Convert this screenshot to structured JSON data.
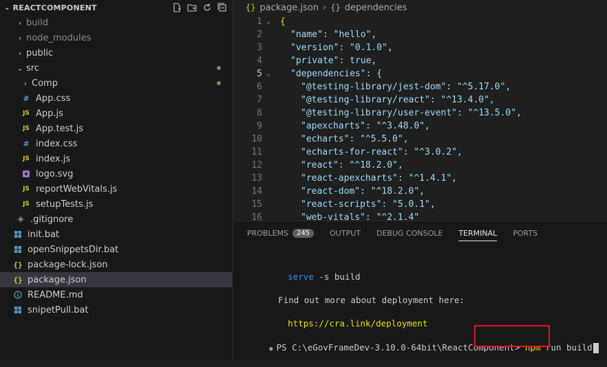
{
  "explorer": {
    "title": "REACTCOMPONENT",
    "items": [
      {
        "label": "build",
        "type": "folder",
        "dim": true
      },
      {
        "label": "node_modules",
        "type": "folder",
        "dim": true
      },
      {
        "label": "public",
        "type": "folder"
      },
      {
        "label": "src",
        "type": "folder-open"
      },
      {
        "label": "Comp",
        "type": "folder"
      },
      {
        "label": "App.css",
        "type": "css"
      },
      {
        "label": "App.js",
        "type": "js"
      },
      {
        "label": "App.test.js",
        "type": "js"
      },
      {
        "label": "index.css",
        "type": "css"
      },
      {
        "label": "index.js",
        "type": "js"
      },
      {
        "label": "logo.svg",
        "type": "svg"
      },
      {
        "label": "reportWebVitals.js",
        "type": "js"
      },
      {
        "label": "setupTests.js",
        "type": "js"
      },
      {
        "label": ".gitignore",
        "type": "git"
      },
      {
        "label": "init.bat",
        "type": "bat"
      },
      {
        "label": "openSnippetsDir.bat",
        "type": "bat"
      },
      {
        "label": "package-lock.json",
        "type": "json"
      },
      {
        "label": "package.json",
        "type": "json"
      },
      {
        "label": "README.md",
        "type": "info"
      },
      {
        "label": "snipetPull.bat",
        "type": "bat"
      }
    ]
  },
  "icons": {
    "css": "#",
    "js": "JS",
    "json": "{}"
  },
  "breadcrumb": {
    "file": "package.json",
    "section": "dependencies",
    "file_icon": "{}",
    "section_icon": "{}"
  },
  "code": {
    "line_numbers": [
      "1",
      "2",
      "3",
      "4",
      "5",
      "6",
      "7",
      "8",
      "9",
      "10",
      "11",
      "12",
      "13",
      "14",
      "15",
      "16"
    ],
    "lines": [
      "{",
      "\"name\": \"hello\",",
      "\"version\": \"0.1.0\",",
      "\"private\": true,",
      "\"dependencies\": {",
      "\"@testing-library/jest-dom\": \"^5.17.0\",",
      "\"@testing-library/react\": \"^13.4.0\",",
      "\"@testing-library/user-event\": \"^13.5.0\",",
      "\"apexcharts\": \"^3.48.0\",",
      "\"echarts\": \"^5.5.0\",",
      "\"echarts-for-react\": \"^3.0.2\",",
      "\"react\": \"^18.2.0\",",
      "\"react-apexcharts\": \"^1.4.1\",",
      "\"react-dom\": \"^18.2.0\",",
      "\"react-scripts\": \"5.0.1\",",
      "\"web-vitals\": \"^2.1.4\""
    ]
  },
  "panel": {
    "tabs": [
      "PROBLEMS",
      "OUTPUT",
      "DEBUG CONSOLE",
      "TERMINAL",
      "PORTS"
    ],
    "problems_count": "245",
    "active_tab": "TERMINAL"
  },
  "terminal": {
    "serve_cmd": "serve",
    "serve_args": " -s build",
    "info": "Find out more about deployment here:",
    "link": "https://cra.link/deployment",
    "prompt": "PS C:\\eGovFrameDev-3.10.0-64bit\\ReactComponent> ",
    "npm": "npm",
    "cmd_rest": " run build"
  },
  "colors": {
    "highlight": "#e81123",
    "accent_yellow": "#e5e510",
    "link_yellow": "#e5e510",
    "terminal_blue": "#3b8eea"
  }
}
